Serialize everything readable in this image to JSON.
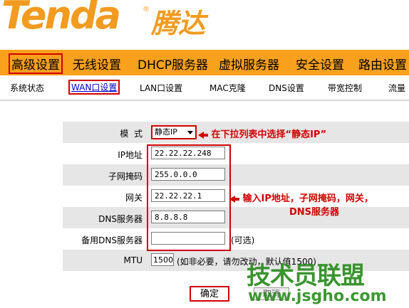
{
  "brand": {
    "logo_en": "Tenda",
    "logo_cn": "腾达",
    "reg": "®"
  },
  "nav": {
    "items": [
      "高级设置",
      "无线设置",
      "DHCP服务器",
      "虚拟服务器",
      "安全设置",
      "路由设置"
    ],
    "active": "高级设置"
  },
  "subnav": {
    "items": [
      "系统状态",
      "WAN口设置",
      "LAN口设置",
      "MAC克隆",
      "DNS设置",
      "带宽控制",
      "流量"
    ],
    "active": "WAN口设置"
  },
  "form": {
    "mode_label": "模  式",
    "mode_value": "静态IP",
    "ip_label": "IP地址",
    "ip_value": "22.22.22.248",
    "mask_label": "子网掩码",
    "mask_value": "255.0.0.0",
    "gateway_label": "网关",
    "gateway_value": "22.22.22.1",
    "dns_label": "DNS服务器",
    "dns_value": "8.8.8.8",
    "dns2_label": "备用DNS服务器",
    "dns2_value": "",
    "dns2_hint": "(可选)",
    "mtu_label": "MTU",
    "mtu_value": "1500",
    "mtu_hint": "(如非必要，请勿改动，默认值1500)"
  },
  "annotations": {
    "select_hint": "在下拉列表中选择“静态IP”",
    "input_hint_line1": "输入IP地址，子网掩码，网关，",
    "input_hint_line2": "DNS服务器"
  },
  "buttons": {
    "confirm": "确定",
    "cancel": "取消"
  },
  "watermark": {
    "line1": "技术员联盟",
    "line2": "www.jsgho.com"
  },
  "colors": {
    "accent": "#f9a01c",
    "logo": "#f29b1f",
    "highlight": "#d20000",
    "watermark": "#2a8c1e"
  }
}
